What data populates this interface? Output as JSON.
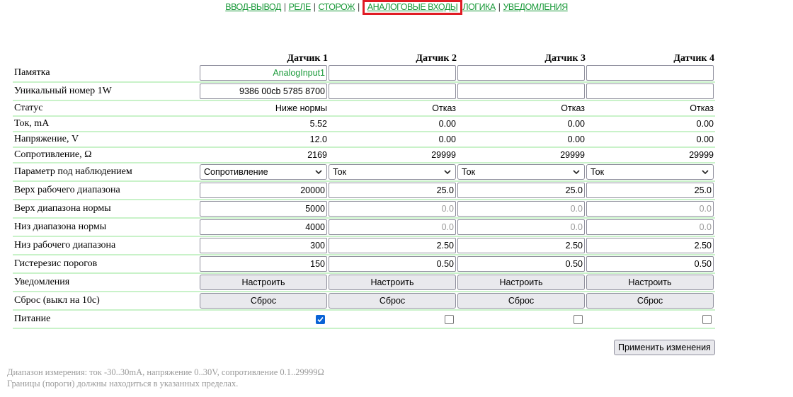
{
  "nav": {
    "items": [
      "ВВОД-ВЫВОД",
      "РЕЛЕ",
      "СТОРОЖ",
      "АНАЛОГОВЫЕ ВХОДЫ",
      "ЛОГИКА",
      "УВЕДОМЛЕНИЯ"
    ],
    "current": "АНАЛОГОВЫЕ ВХОДЫ",
    "separator": "|"
  },
  "headers": [
    "Датчик 1",
    "Датчик 2",
    "Датчик 3",
    "Датчик 4"
  ],
  "rows": {
    "memo": {
      "label": "Памятка",
      "values": [
        "AnalogInput1",
        "",
        "",
        ""
      ]
    },
    "uid": {
      "label": "Уникальный номер 1W",
      "values": [
        "9386 00cb 5785 8700",
        "",
        "",
        ""
      ]
    },
    "status": {
      "label": "Статус",
      "values": [
        "Ниже нормы",
        "Отказ",
        "Отказ",
        "Отказ"
      ]
    },
    "current": {
      "label": "Ток, mA",
      "values": [
        "5.52",
        "0.00",
        "0.00",
        "0.00"
      ]
    },
    "voltage": {
      "label": "Напряжение, V",
      "values": [
        "12.0",
        "0.00",
        "0.00",
        "0.00"
      ]
    },
    "resistance": {
      "label": "Сопротивление, Ω",
      "values": [
        "2169",
        "29999",
        "29999",
        "29999"
      ]
    },
    "param": {
      "label": "Параметр под наблюдением",
      "values": [
        "Сопротивление",
        "Ток",
        "Ток",
        "Ток"
      ]
    },
    "work_top": {
      "label": "Верх рабочего диапазона",
      "values": [
        "20000",
        "25.0",
        "25.0",
        "25.0"
      ]
    },
    "norm_top": {
      "label": "Верх диапазона нормы",
      "values": [
        "5000",
        "",
        "",
        ""
      ],
      "placeholders": [
        "",
        "0.0",
        "0.0",
        "0.0"
      ]
    },
    "norm_bottom": {
      "label": "Низ диапазона нормы",
      "values": [
        "4000",
        "",
        "",
        ""
      ],
      "placeholders": [
        "",
        "0.0",
        "0.0",
        "0.0"
      ]
    },
    "work_bottom": {
      "label": "Низ рабочего диапазона",
      "values": [
        "300",
        "2.50",
        "2.50",
        "2.50"
      ]
    },
    "hysteresis": {
      "label": "Гистерезис порогов",
      "values": [
        "150",
        "0.50",
        "0.50",
        "0.50"
      ]
    },
    "notify": {
      "label": "Уведомления",
      "button": "Настроить"
    },
    "reset": {
      "label": "Сброс (выкл на 10с)",
      "button": "Сброс"
    },
    "power": {
      "label": "Питание",
      "checked": [
        true,
        false,
        false,
        false
      ]
    }
  },
  "apply_button": "Применить изменения",
  "notes": [
    "Диапазон измерения: ток -30..30mA, напряжение 0..30V, сопротивление 0.1..29999Ω",
    "Границы (пороги) должны находиться в указанных пределах."
  ],
  "colors": {
    "link": "#1b9a3a",
    "highlight": "#e01b24",
    "row_divider": "#c9f2c9",
    "checkbox_on": "#0a63d6"
  }
}
